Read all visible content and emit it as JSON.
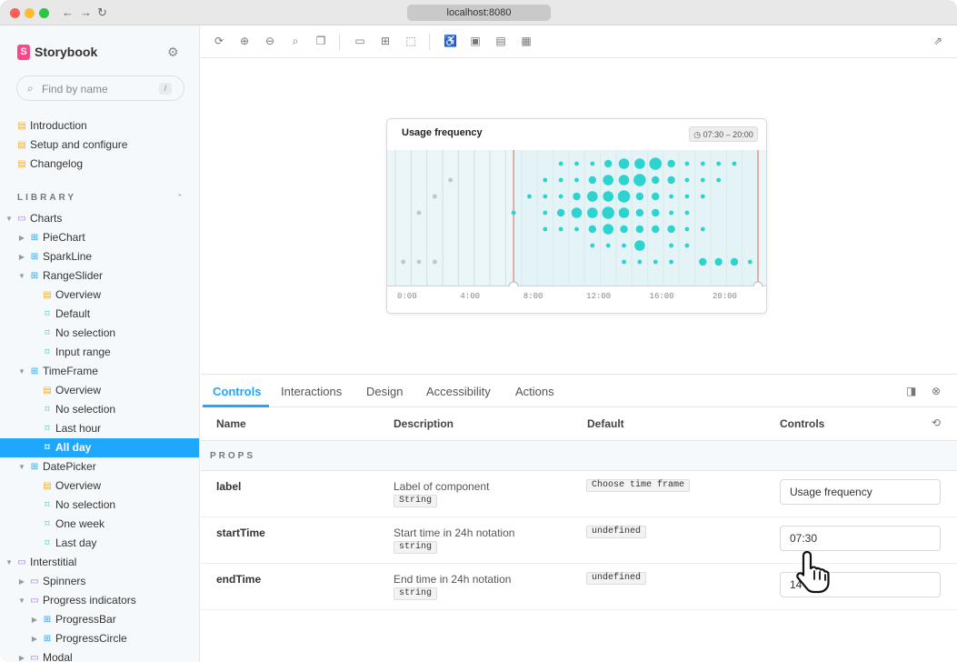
{
  "browser": {
    "url": "localhost:8080"
  },
  "sidebar": {
    "brand": "Storybook",
    "search_placeholder": "Find by name",
    "search_shortcut": "/",
    "section_label": "LIBRARY",
    "docs": [
      "Introduction",
      "Setup and configure",
      "Changelog"
    ],
    "tree": [
      {
        "label": "Charts",
        "kind": "folder",
        "level": 0,
        "expanded": true
      },
      {
        "label": "PieChart",
        "kind": "component",
        "level": 1,
        "expanded": false
      },
      {
        "label": "SparkLine",
        "kind": "component",
        "level": 1,
        "expanded": false
      },
      {
        "label": "RangeSlider",
        "kind": "component",
        "level": 1,
        "expanded": true
      },
      {
        "label": "Overview",
        "kind": "doc",
        "level": 2
      },
      {
        "label": "Default",
        "kind": "story",
        "level": 2
      },
      {
        "label": "No selection",
        "kind": "story",
        "level": 2
      },
      {
        "label": "Input range",
        "kind": "story",
        "level": 2
      },
      {
        "label": "TimeFrame",
        "kind": "component",
        "level": 1,
        "expanded": true
      },
      {
        "label": "Overview",
        "kind": "doc",
        "level": 2
      },
      {
        "label": "No selection",
        "kind": "story",
        "level": 2
      },
      {
        "label": "Last hour",
        "kind": "story",
        "level": 2
      },
      {
        "label": "All day",
        "kind": "story",
        "level": 2,
        "selected": true
      },
      {
        "label": "DatePicker",
        "kind": "component",
        "level": 1,
        "expanded": true
      },
      {
        "label": "Overview",
        "kind": "doc",
        "level": 2
      },
      {
        "label": "No selection",
        "kind": "story",
        "level": 2
      },
      {
        "label": "One week",
        "kind": "story",
        "level": 2
      },
      {
        "label": "Last day",
        "kind": "story",
        "level": 2
      },
      {
        "label": "Interstitial",
        "kind": "folder",
        "level": 0,
        "expanded": true
      },
      {
        "label": "Spinners",
        "kind": "folder",
        "level": 1,
        "expanded": false
      },
      {
        "label": "Progress indicators",
        "kind": "folder",
        "level": 1,
        "expanded": true
      },
      {
        "label": "ProgressBar",
        "kind": "component",
        "level": 2,
        "expanded": false
      },
      {
        "label": "ProgressCircle",
        "kind": "component",
        "level": 2,
        "expanded": false
      },
      {
        "label": "Modal",
        "kind": "folder",
        "level": 1,
        "expanded": false
      }
    ]
  },
  "preview": {
    "title": "Usage frequency",
    "range_label": "07:30 – 20:00",
    "x_ticks": [
      "0:00",
      "4:00",
      "8:00",
      "12:00",
      "16:00",
      "20:00"
    ]
  },
  "chart_data": {
    "type": "scatter",
    "xlabel": "",
    "ylabel": "",
    "xlim": [
      0,
      23
    ],
    "rows": 7,
    "selection": [
      7.5,
      23
    ],
    "points": [
      [
        10.5,
        0,
        1
      ],
      [
        11.5,
        0,
        1
      ],
      [
        12.5,
        0,
        1
      ],
      [
        13.5,
        0,
        2
      ],
      [
        14.5,
        0,
        3
      ],
      [
        15.5,
        0,
        3
      ],
      [
        16.5,
        0,
        4
      ],
      [
        17.5,
        0,
        2
      ],
      [
        18.5,
        0,
        1
      ],
      [
        19.5,
        0,
        1
      ],
      [
        20.5,
        0,
        1
      ],
      [
        21.5,
        0,
        1
      ],
      [
        3.5,
        1,
        1
      ],
      [
        9.5,
        1,
        1
      ],
      [
        10.5,
        1,
        1
      ],
      [
        11.5,
        1,
        1
      ],
      [
        12.5,
        1,
        2
      ],
      [
        13.5,
        1,
        3
      ],
      [
        14.5,
        1,
        3
      ],
      [
        15.5,
        1,
        4
      ],
      [
        16.5,
        1,
        2
      ],
      [
        17.5,
        1,
        2
      ],
      [
        18.5,
        1,
        1
      ],
      [
        19.5,
        1,
        1
      ],
      [
        20.5,
        1,
        1
      ],
      [
        2.5,
        2,
        1
      ],
      [
        8.5,
        2,
        1
      ],
      [
        9.5,
        2,
        1
      ],
      [
        10.5,
        2,
        1
      ],
      [
        11.5,
        2,
        2
      ],
      [
        12.5,
        2,
        3
      ],
      [
        13.5,
        2,
        3
      ],
      [
        14.5,
        2,
        4
      ],
      [
        15.5,
        2,
        2
      ],
      [
        16.5,
        2,
        2
      ],
      [
        17.5,
        2,
        1
      ],
      [
        18.5,
        2,
        1
      ],
      [
        19.5,
        2,
        1
      ],
      [
        1.5,
        3,
        1
      ],
      [
        7.5,
        3,
        1
      ],
      [
        9.5,
        3,
        1
      ],
      [
        10.5,
        3,
        2
      ],
      [
        11.5,
        3,
        3
      ],
      [
        12.5,
        3,
        3
      ],
      [
        13.5,
        3,
        4
      ],
      [
        14.5,
        3,
        3
      ],
      [
        15.5,
        3,
        2
      ],
      [
        16.5,
        3,
        2
      ],
      [
        17.5,
        3,
        1
      ],
      [
        18.5,
        3,
        1
      ],
      [
        9.5,
        4,
        1
      ],
      [
        10.5,
        4,
        1
      ],
      [
        11.5,
        4,
        1
      ],
      [
        12.5,
        4,
        2
      ],
      [
        13.5,
        4,
        3
      ],
      [
        14.5,
        4,
        2
      ],
      [
        15.5,
        4,
        2
      ],
      [
        16.5,
        4,
        2
      ],
      [
        17.5,
        4,
        2
      ],
      [
        18.5,
        4,
        1
      ],
      [
        19.5,
        4,
        1
      ],
      [
        12.5,
        5,
        1
      ],
      [
        13.5,
        5,
        1
      ],
      [
        14.5,
        5,
        1
      ],
      [
        15.5,
        5,
        3
      ],
      [
        17.5,
        5,
        1
      ],
      [
        18.5,
        5,
        1
      ],
      [
        0.5,
        6,
        1
      ],
      [
        1.5,
        6,
        1
      ],
      [
        2.5,
        6,
        1
      ],
      [
        14.5,
        6,
        1
      ],
      [
        15.5,
        6,
        1
      ],
      [
        16.5,
        6,
        1
      ],
      [
        17.5,
        6,
        1
      ],
      [
        19.5,
        6,
        2
      ],
      [
        20.5,
        6,
        2
      ],
      [
        21.5,
        6,
        2
      ],
      [
        22.5,
        6,
        1
      ]
    ]
  },
  "panel": {
    "tabs": [
      "Controls",
      "Interactions",
      "Design",
      "Accessibility",
      "Actions"
    ],
    "columns": {
      "name": "Name",
      "description": "Description",
      "default": "Default",
      "controls": "Controls"
    },
    "section": "PROPS",
    "props": [
      {
        "name": "label",
        "description": "Label of component",
        "type": "String",
        "default": "Choose time frame",
        "value": "Usage frequency"
      },
      {
        "name": "startTime",
        "description": "Start time in 24h notation",
        "type": "string",
        "default": "undefined",
        "value": "07:30"
      },
      {
        "name": "endTime",
        "description": "End time in 24h notation",
        "type": "string",
        "default": "undefined",
        "value": "14"
      }
    ]
  },
  "colors": {
    "accent": "#1ea7fd",
    "brand": "#ff4785",
    "dot": "#2dd4cf",
    "marker": "#e0826f",
    "plot_bg": "#eaf6f8"
  }
}
